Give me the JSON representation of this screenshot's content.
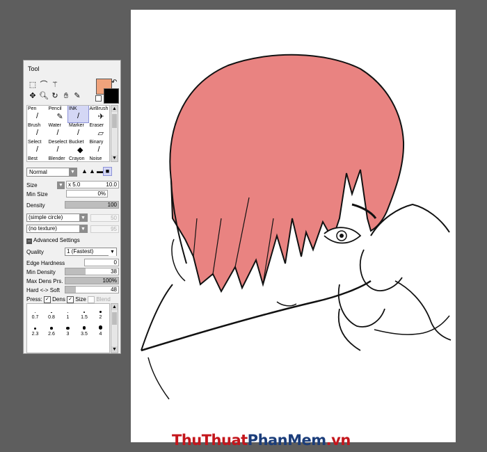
{
  "panel": {
    "title": "Tool"
  },
  "colors": {
    "foreground": "#f0a37c",
    "background": "#000000",
    "hair": "#e98381",
    "selected_brush": "#d4d7f5"
  },
  "selection_tools": [
    "rect-select-icon",
    "lasso-icon",
    "magic-wand-icon",
    "",
    "move-icon",
    "zoom-icon",
    "rotate-icon",
    "hand-icon",
    "eyedropper-icon"
  ],
  "brushes": [
    {
      "label": "Pen",
      "icon": "pen-icon"
    },
    {
      "label": "Pencil",
      "icon": "pencil-icon"
    },
    {
      "label": "INK",
      "icon": "ink-icon",
      "selected": true
    },
    {
      "label": "AirBrush",
      "icon": "airbrush-icon"
    },
    {
      "label": "Brush",
      "icon": "brush-icon"
    },
    {
      "label": "Water",
      "icon": "water-icon"
    },
    {
      "label": "Marker",
      "icon": "marker-icon"
    },
    {
      "label": "Eraser",
      "icon": "eraser-icon"
    },
    {
      "label": "Select",
      "icon": "select-brush-icon"
    },
    {
      "label": "Deselect",
      "icon": "deselect-brush-icon"
    },
    {
      "label": "Bucket",
      "icon": "bucket-icon"
    },
    {
      "label": "Binary",
      "icon": "binary-icon"
    },
    {
      "label": "Best",
      "icon": "best-icon"
    },
    {
      "label": "Blender",
      "icon": "blender-icon"
    },
    {
      "label": "Crayon",
      "icon": "crayon-icon"
    },
    {
      "label": "Noise",
      "icon": "noise-icon"
    }
  ],
  "blend_mode": "Normal",
  "size": {
    "label": "Size",
    "multiplier": "x 5.0",
    "value": "10.0"
  },
  "min_size": {
    "label": "Min Size",
    "value": "0%"
  },
  "density": {
    "label": "Density",
    "value": "100",
    "fraction": 1.0
  },
  "shape_select": "(simple circle)",
  "shape_value": "50",
  "texture_select": "(no texture)",
  "texture_value": "95",
  "advanced": {
    "title": "Advanced Settings",
    "quality": {
      "label": "Quality",
      "value": "1 (Fastest)"
    },
    "edge_hardness": {
      "label": "Edge Hardness",
      "value": "0",
      "fraction": 0
    },
    "min_density": {
      "label": "Min Density",
      "value": "38",
      "fraction": 0.38
    },
    "max_dens_prs": {
      "label": "Max Dens Prs.",
      "value": "100%",
      "fraction": 1.0
    },
    "hard_soft": {
      "label": "Hard <-> Soft",
      "value": "48",
      "fraction": 0.2
    }
  },
  "press": {
    "label": "Press:",
    "dens": "Dens",
    "size": "Size",
    "blend": "Blend"
  },
  "brush_sizes": [
    "0.7",
    "0.8",
    "1",
    "1.5",
    "2",
    "2.3",
    "2.6",
    "3",
    "3.5",
    "4"
  ],
  "watermark": {
    "part1": "ThuThuat",
    "part2": "PhanMem",
    "part3": ".vn"
  }
}
